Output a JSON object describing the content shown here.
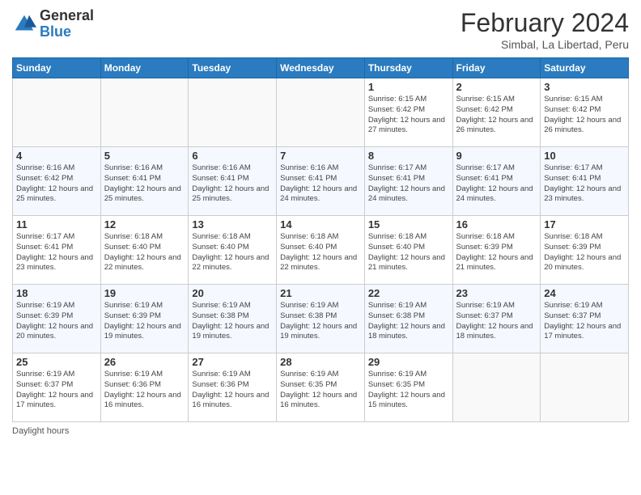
{
  "logo": {
    "general": "General",
    "blue": "Blue"
  },
  "header": {
    "month": "February 2024",
    "location": "Simbal, La Libertad, Peru"
  },
  "days_of_week": [
    "Sunday",
    "Monday",
    "Tuesday",
    "Wednesday",
    "Thursday",
    "Friday",
    "Saturday"
  ],
  "footer": {
    "daylight_label": "Daylight hours"
  },
  "weeks": [
    [
      {
        "day": "",
        "info": ""
      },
      {
        "day": "",
        "info": ""
      },
      {
        "day": "",
        "info": ""
      },
      {
        "day": "",
        "info": ""
      },
      {
        "day": "1",
        "info": "Sunrise: 6:15 AM\nSunset: 6:42 PM\nDaylight: 12 hours and 27 minutes."
      },
      {
        "day": "2",
        "info": "Sunrise: 6:15 AM\nSunset: 6:42 PM\nDaylight: 12 hours and 26 minutes."
      },
      {
        "day": "3",
        "info": "Sunrise: 6:15 AM\nSunset: 6:42 PM\nDaylight: 12 hours and 26 minutes."
      }
    ],
    [
      {
        "day": "4",
        "info": "Sunrise: 6:16 AM\nSunset: 6:42 PM\nDaylight: 12 hours and 25 minutes."
      },
      {
        "day": "5",
        "info": "Sunrise: 6:16 AM\nSunset: 6:41 PM\nDaylight: 12 hours and 25 minutes."
      },
      {
        "day": "6",
        "info": "Sunrise: 6:16 AM\nSunset: 6:41 PM\nDaylight: 12 hours and 25 minutes."
      },
      {
        "day": "7",
        "info": "Sunrise: 6:16 AM\nSunset: 6:41 PM\nDaylight: 12 hours and 24 minutes."
      },
      {
        "day": "8",
        "info": "Sunrise: 6:17 AM\nSunset: 6:41 PM\nDaylight: 12 hours and 24 minutes."
      },
      {
        "day": "9",
        "info": "Sunrise: 6:17 AM\nSunset: 6:41 PM\nDaylight: 12 hours and 24 minutes."
      },
      {
        "day": "10",
        "info": "Sunrise: 6:17 AM\nSunset: 6:41 PM\nDaylight: 12 hours and 23 minutes."
      }
    ],
    [
      {
        "day": "11",
        "info": "Sunrise: 6:17 AM\nSunset: 6:41 PM\nDaylight: 12 hours and 23 minutes."
      },
      {
        "day": "12",
        "info": "Sunrise: 6:18 AM\nSunset: 6:40 PM\nDaylight: 12 hours and 22 minutes."
      },
      {
        "day": "13",
        "info": "Sunrise: 6:18 AM\nSunset: 6:40 PM\nDaylight: 12 hours and 22 minutes."
      },
      {
        "day": "14",
        "info": "Sunrise: 6:18 AM\nSunset: 6:40 PM\nDaylight: 12 hours and 22 minutes."
      },
      {
        "day": "15",
        "info": "Sunrise: 6:18 AM\nSunset: 6:40 PM\nDaylight: 12 hours and 21 minutes."
      },
      {
        "day": "16",
        "info": "Sunrise: 6:18 AM\nSunset: 6:39 PM\nDaylight: 12 hours and 21 minutes."
      },
      {
        "day": "17",
        "info": "Sunrise: 6:18 AM\nSunset: 6:39 PM\nDaylight: 12 hours and 20 minutes."
      }
    ],
    [
      {
        "day": "18",
        "info": "Sunrise: 6:19 AM\nSunset: 6:39 PM\nDaylight: 12 hours and 20 minutes."
      },
      {
        "day": "19",
        "info": "Sunrise: 6:19 AM\nSunset: 6:39 PM\nDaylight: 12 hours and 19 minutes."
      },
      {
        "day": "20",
        "info": "Sunrise: 6:19 AM\nSunset: 6:38 PM\nDaylight: 12 hours and 19 minutes."
      },
      {
        "day": "21",
        "info": "Sunrise: 6:19 AM\nSunset: 6:38 PM\nDaylight: 12 hours and 19 minutes."
      },
      {
        "day": "22",
        "info": "Sunrise: 6:19 AM\nSunset: 6:38 PM\nDaylight: 12 hours and 18 minutes."
      },
      {
        "day": "23",
        "info": "Sunrise: 6:19 AM\nSunset: 6:37 PM\nDaylight: 12 hours and 18 minutes."
      },
      {
        "day": "24",
        "info": "Sunrise: 6:19 AM\nSunset: 6:37 PM\nDaylight: 12 hours and 17 minutes."
      }
    ],
    [
      {
        "day": "25",
        "info": "Sunrise: 6:19 AM\nSunset: 6:37 PM\nDaylight: 12 hours and 17 minutes."
      },
      {
        "day": "26",
        "info": "Sunrise: 6:19 AM\nSunset: 6:36 PM\nDaylight: 12 hours and 16 minutes."
      },
      {
        "day": "27",
        "info": "Sunrise: 6:19 AM\nSunset: 6:36 PM\nDaylight: 12 hours and 16 minutes."
      },
      {
        "day": "28",
        "info": "Sunrise: 6:19 AM\nSunset: 6:35 PM\nDaylight: 12 hours and 16 minutes."
      },
      {
        "day": "29",
        "info": "Sunrise: 6:19 AM\nSunset: 6:35 PM\nDaylight: 12 hours and 15 minutes."
      },
      {
        "day": "",
        "info": ""
      },
      {
        "day": "",
        "info": ""
      }
    ]
  ]
}
